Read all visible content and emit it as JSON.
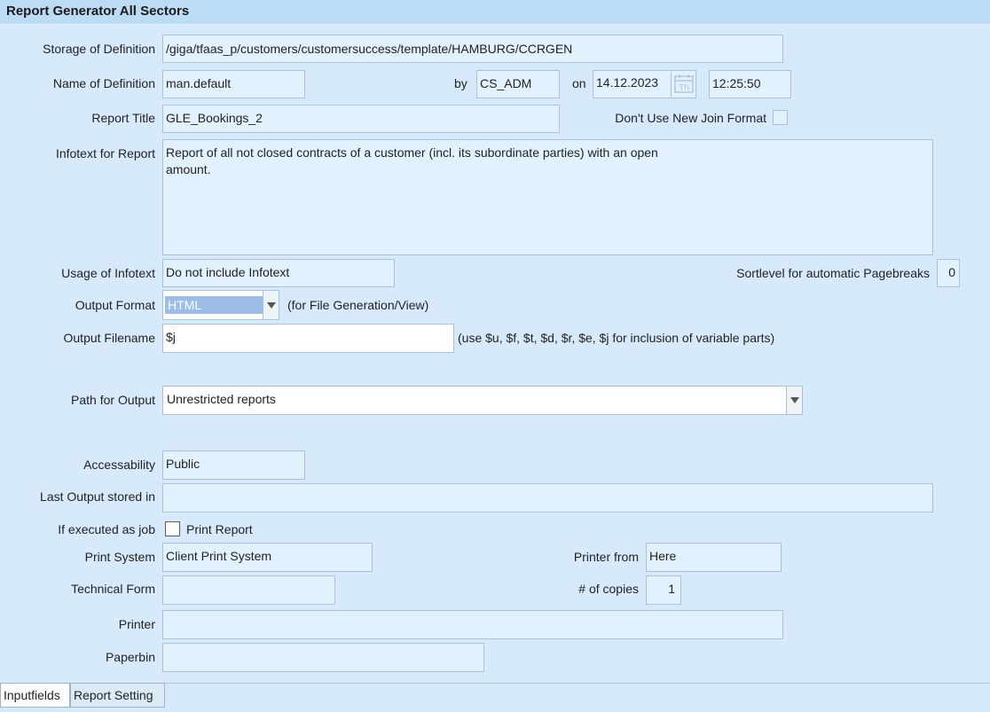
{
  "window": {
    "title": "Report Generator All Sectors"
  },
  "form": {
    "storage_label": "Storage of Definition",
    "storage_value": "/giga/tfaas_p/customers/customersuccess/template/HAMBURG/CCRGEN",
    "name_label": "Name of Definition",
    "name_value": "man.default",
    "by_label": "by",
    "by_value": "CS_ADM",
    "on_label": "on",
    "date_value": "14.12.2023",
    "calendar_icon_text": "Th",
    "time_value": "12:25:50",
    "title_label": "Report Title",
    "title_value": "GLE_Bookings_2",
    "join_label": "Don't Use New Join Format",
    "infotext_label": "Infotext for Report",
    "infotext_value": "Report of all not closed contracts of a customer (incl. its subordinate parties) with an open\namount.",
    "usage_label": "Usage of Infotext",
    "usage_value": "Do not include Infotext",
    "sortlevel_label": "Sortlevel for automatic Pagebreaks",
    "sortlevel_value": "0",
    "output_format_label": "Output Format",
    "output_format_value": "HTML",
    "output_format_hint": "(for File Generation/View)",
    "output_filename_label": "Output Filename",
    "output_filename_value": "$j",
    "output_filename_hint": "(use $u, $f, $t, $d, $r, $e, $j for inclusion of variable parts)",
    "path_label": "Path for Output",
    "path_value": "Unrestricted reports",
    "access_label": "Accessability",
    "access_value": "Public",
    "last_output_label": "Last Output stored in",
    "last_output_value": "",
    "job_label": "If executed as job",
    "print_report_label": "Print Report",
    "print_system_label": "Print System",
    "print_system_value": "Client Print System",
    "printer_from_label": "Printer from",
    "printer_from_value": "Here",
    "technical_form_label": "Technical Form",
    "technical_form_value": "",
    "copies_label": "# of copies",
    "copies_value": "1",
    "printer_label": "Printer",
    "printer_value": "",
    "paperbin_label": "Paperbin",
    "paperbin_value": ""
  },
  "tabs": [
    {
      "label": "Inputfields",
      "active": true
    },
    {
      "label": "Report Setting",
      "active": false
    }
  ]
}
